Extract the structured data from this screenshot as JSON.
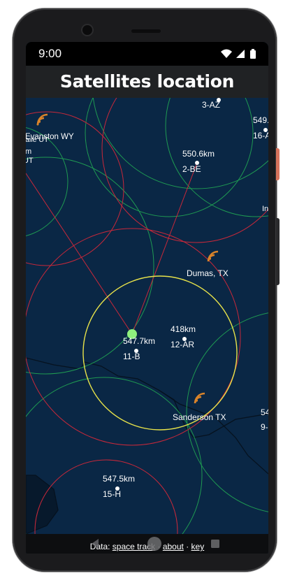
{
  "status_bar": {
    "time": "9:00",
    "icons": [
      "wifi-icon",
      "cell-signal-icon",
      "battery-icon"
    ]
  },
  "app": {
    "title": "Satellites location"
  },
  "map": {
    "colors": {
      "background": "#0a2745",
      "selected_ring": "#e8e34a",
      "coverage_red": "#c8283a",
      "coverage_green": "#1f9a52",
      "selected_dot": "#8ff07e",
      "ground_station": "#d9832a"
    },
    "satellites": [
      {
        "id": "3-AZ",
        "altitude": ""
      },
      {
        "id": "16-A",
        "altitude": "549."
      },
      {
        "id": "2-BE",
        "altitude": "550.6km"
      },
      {
        "id": "11-B",
        "altitude": "547.7km",
        "selected": true
      },
      {
        "id": "12-AR",
        "altitude": "418km"
      },
      {
        "id": "9-",
        "altitude": "54"
      },
      {
        "id": "15-H",
        "altitude": "547.5km"
      }
    ],
    "ground_stations": [
      {
        "label": "Evanston WY",
        "sublabel": "alaile UT"
      },
      {
        "label": "Dumas, TX"
      },
      {
        "label": "Sanderson TX"
      }
    ],
    "edge_labels": [
      "m",
      "UT",
      "In"
    ]
  },
  "footer": {
    "prefix": "Data: ",
    "link_spacetrack": "space track",
    "sep1": " · ",
    "link_about": "about",
    "sep2": " · ",
    "link_key": "key"
  }
}
